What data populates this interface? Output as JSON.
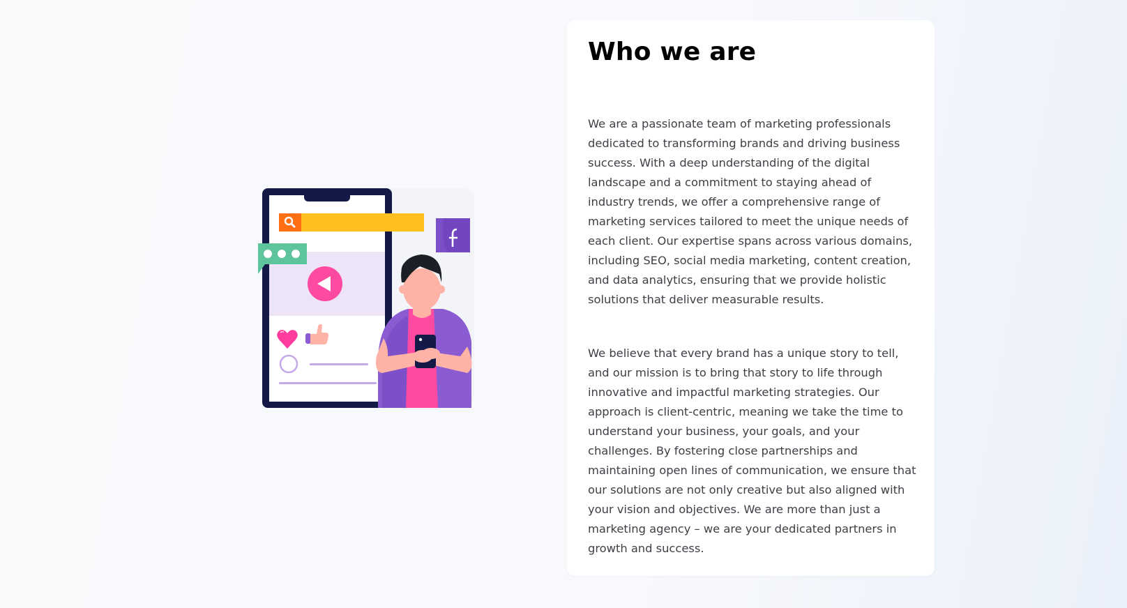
{
  "about": {
    "title": "Who we are",
    "paragraphs": [
      "We are a passionate team of marketing professionals dedicated to transforming brands and driving business success. With a deep understanding of the digital landscape and a commitment to staying ahead of industry trends, we offer a comprehensive range of marketing services tailored to meet the unique needs of each client. Our expertise spans across various domains, including SEO, social media marketing, content creation, and data analytics, ensuring that we provide holistic solutions that deliver measurable results.",
      "We believe that every brand has a unique story to tell, and our mission is to bring that story to life through innovative and impactful marketing strategies. Our approach is client-centric, meaning we take the time to understand your business, your goals, and your challenges. By fostering close partnerships and maintaining open lines of communication, we ensure that our solutions are not only creative but also aligned with your vision and objectives. We are more than just a marketing agency – we are your dedicated partners in growth and success."
    ]
  },
  "illustration": {
    "subject": "person-holding-phone-social-media",
    "icons": [
      "search-icon",
      "facebook-icon",
      "chat-bubble-icon",
      "play-button-icon",
      "heart-icon",
      "thumbs-up-icon"
    ],
    "colors": {
      "phone_frame": "#141a48",
      "search_bar": "#ffc01f",
      "search_button": "#ff6f12",
      "facebook_square": "#7b4fc9",
      "chat_bubble": "#5ec49b",
      "video_area": "#ede5f7",
      "play_button": "#ff4aa2",
      "shirt": "#ff4aa2",
      "jacket": "#8a5bd1",
      "skin": "#ffb3a7",
      "hair": "#1d1f27"
    }
  }
}
